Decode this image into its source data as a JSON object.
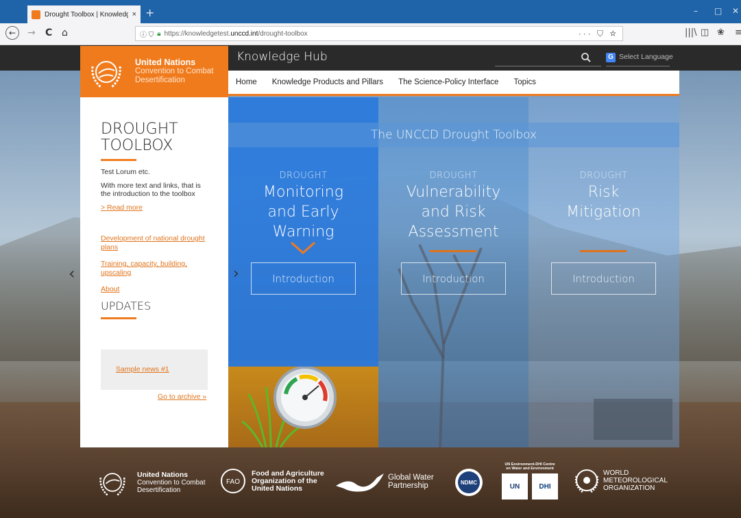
{
  "browser": {
    "tab_title": "Drought Toolbox | Knowledge Hub",
    "tab_close": "×",
    "new_tab": "+",
    "url_scheme": "https://",
    "url_host_prefix": "knowledgetest.",
    "url_host_main": "unccd.int",
    "url_path": "/drought-toolbox",
    "page_tools": "··· ⛉ ☆",
    "win_minimize": "–",
    "win_maximize": "□",
    "win_close": "✕",
    "back": "←",
    "forward": "→",
    "reload": "C",
    "home": "⌂",
    "library": "|||\\",
    "sidebar_toggle": "◫",
    "extension": "❀",
    "menu": "≡"
  },
  "header": {
    "org_name": "United Nations",
    "org_sub1": "Convention to Combat",
    "org_sub2": "Desertification",
    "hub_title": "Knowledge Hub",
    "select_language": "Select Language",
    "google_g": "G"
  },
  "menu": [
    "Home",
    "Knowledge Products and Pillars",
    "The Science-Policy Interface",
    "Topics"
  ],
  "sidebar": {
    "title1": "DROUGHT",
    "title2": "TOOLBOX",
    "text1": "Test Lorum etc.",
    "text2": "With more text and links, that is the introduction to the toolbox",
    "read_more": "> Read more",
    "links": [
      "Development of national drought plans",
      "Training, capacity, building, upscaling",
      "About"
    ],
    "updates_title": "UPDATES",
    "news": "Sample news #1",
    "archive": "Go to archive »"
  },
  "toolbox": {
    "band_title": "The UNCCD Drought Toolbox",
    "columns": [
      {
        "kicker": "DROUGHT",
        "lines": [
          "Monitoring",
          "and Early",
          "Warning"
        ],
        "button": "Introduction"
      },
      {
        "kicker": "DROUGHT",
        "lines": [
          "Vulnerability",
          "and Risk",
          "Assessment"
        ],
        "button": "Introduction"
      },
      {
        "kicker": "DROUGHT",
        "lines": [
          "Risk",
          "Mitigation"
        ],
        "button": "Introduction"
      }
    ]
  },
  "footer": {
    "unccd": [
      "United Nations",
      "Convention to Combat",
      "Desertification"
    ],
    "fao": [
      "Food and Agriculture",
      "Organization of the",
      "United Nations"
    ],
    "gwp": [
      "Global Water",
      "Partnership"
    ],
    "ndmc": "NDMC",
    "unep_dhi_title": [
      "UN Environment-DHI Centre",
      "on Water and Environment"
    ],
    "un": "UN",
    "dhi": "DHI",
    "wmo": [
      "WORLD",
      "METEOROLOGICAL",
      "ORGANIZATION"
    ]
  },
  "colors": {
    "accent": "#f07b1d",
    "blue": "#2878dc",
    "chrome": "#1f63a8"
  }
}
